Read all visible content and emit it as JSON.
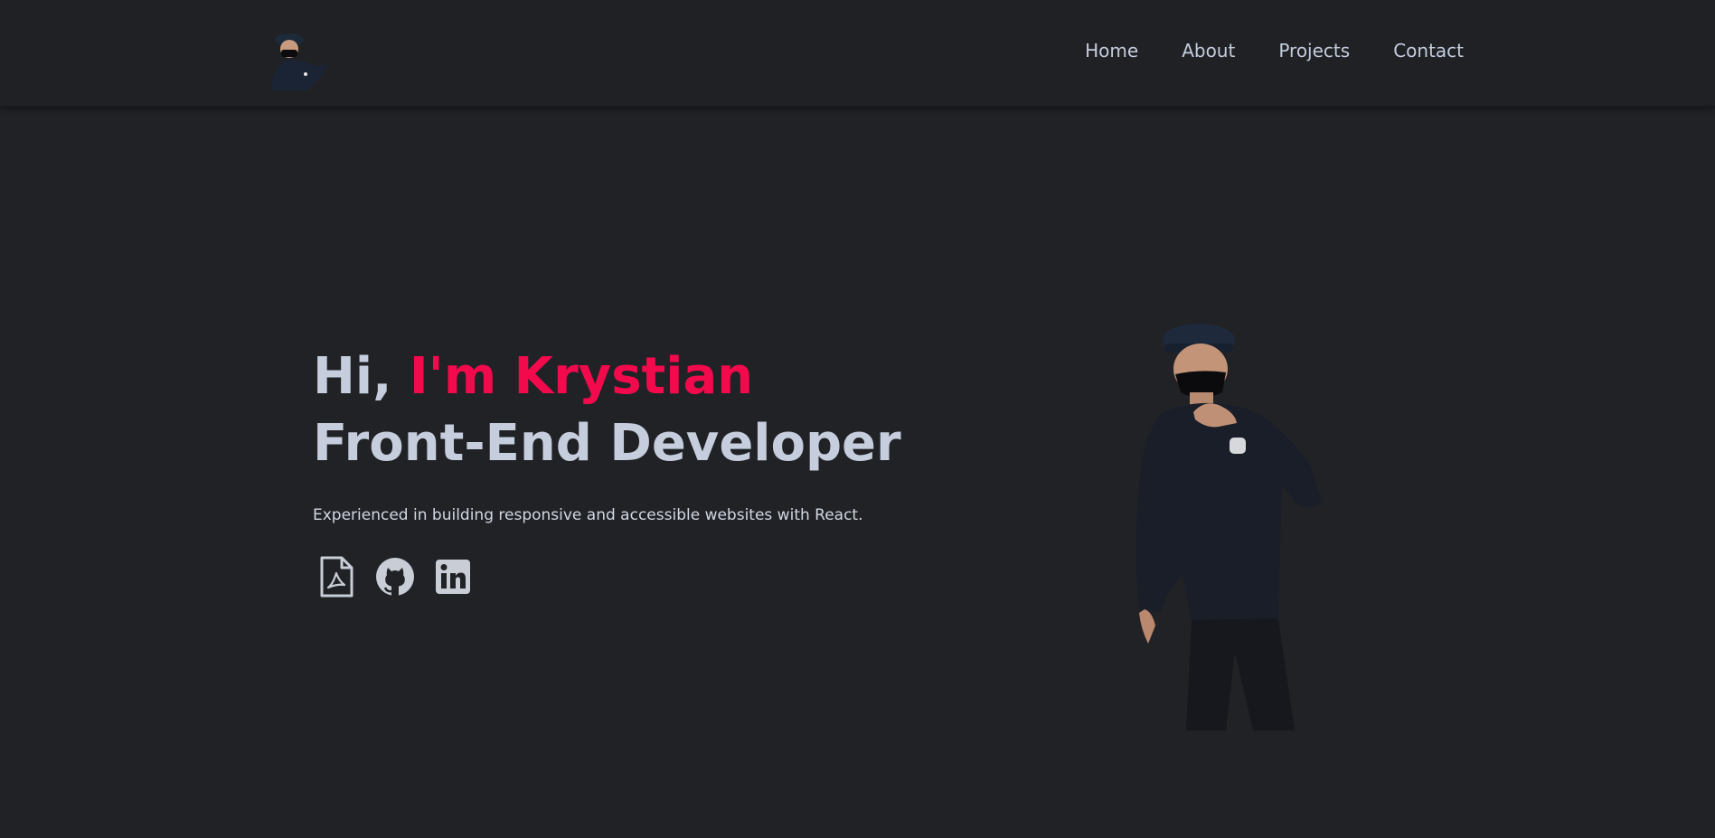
{
  "header": {
    "logo_icon": "avatar-icon",
    "nav": [
      {
        "label": "Home"
      },
      {
        "label": "About"
      },
      {
        "label": "Projects"
      },
      {
        "label": "Contact"
      }
    ]
  },
  "hero": {
    "greeting": "Hi,",
    "name": "I'm Krystian",
    "role": "Front-End Developer",
    "tagline": "Experienced in building responsive and accessible websites with React.",
    "socials": [
      {
        "icon": "pdf-resume-icon"
      },
      {
        "icon": "github-icon"
      },
      {
        "icon": "linkedin-icon"
      }
    ]
  },
  "colors": {
    "background": "#202226",
    "accent": "#f20a4c",
    "text": "#c6cedd"
  }
}
